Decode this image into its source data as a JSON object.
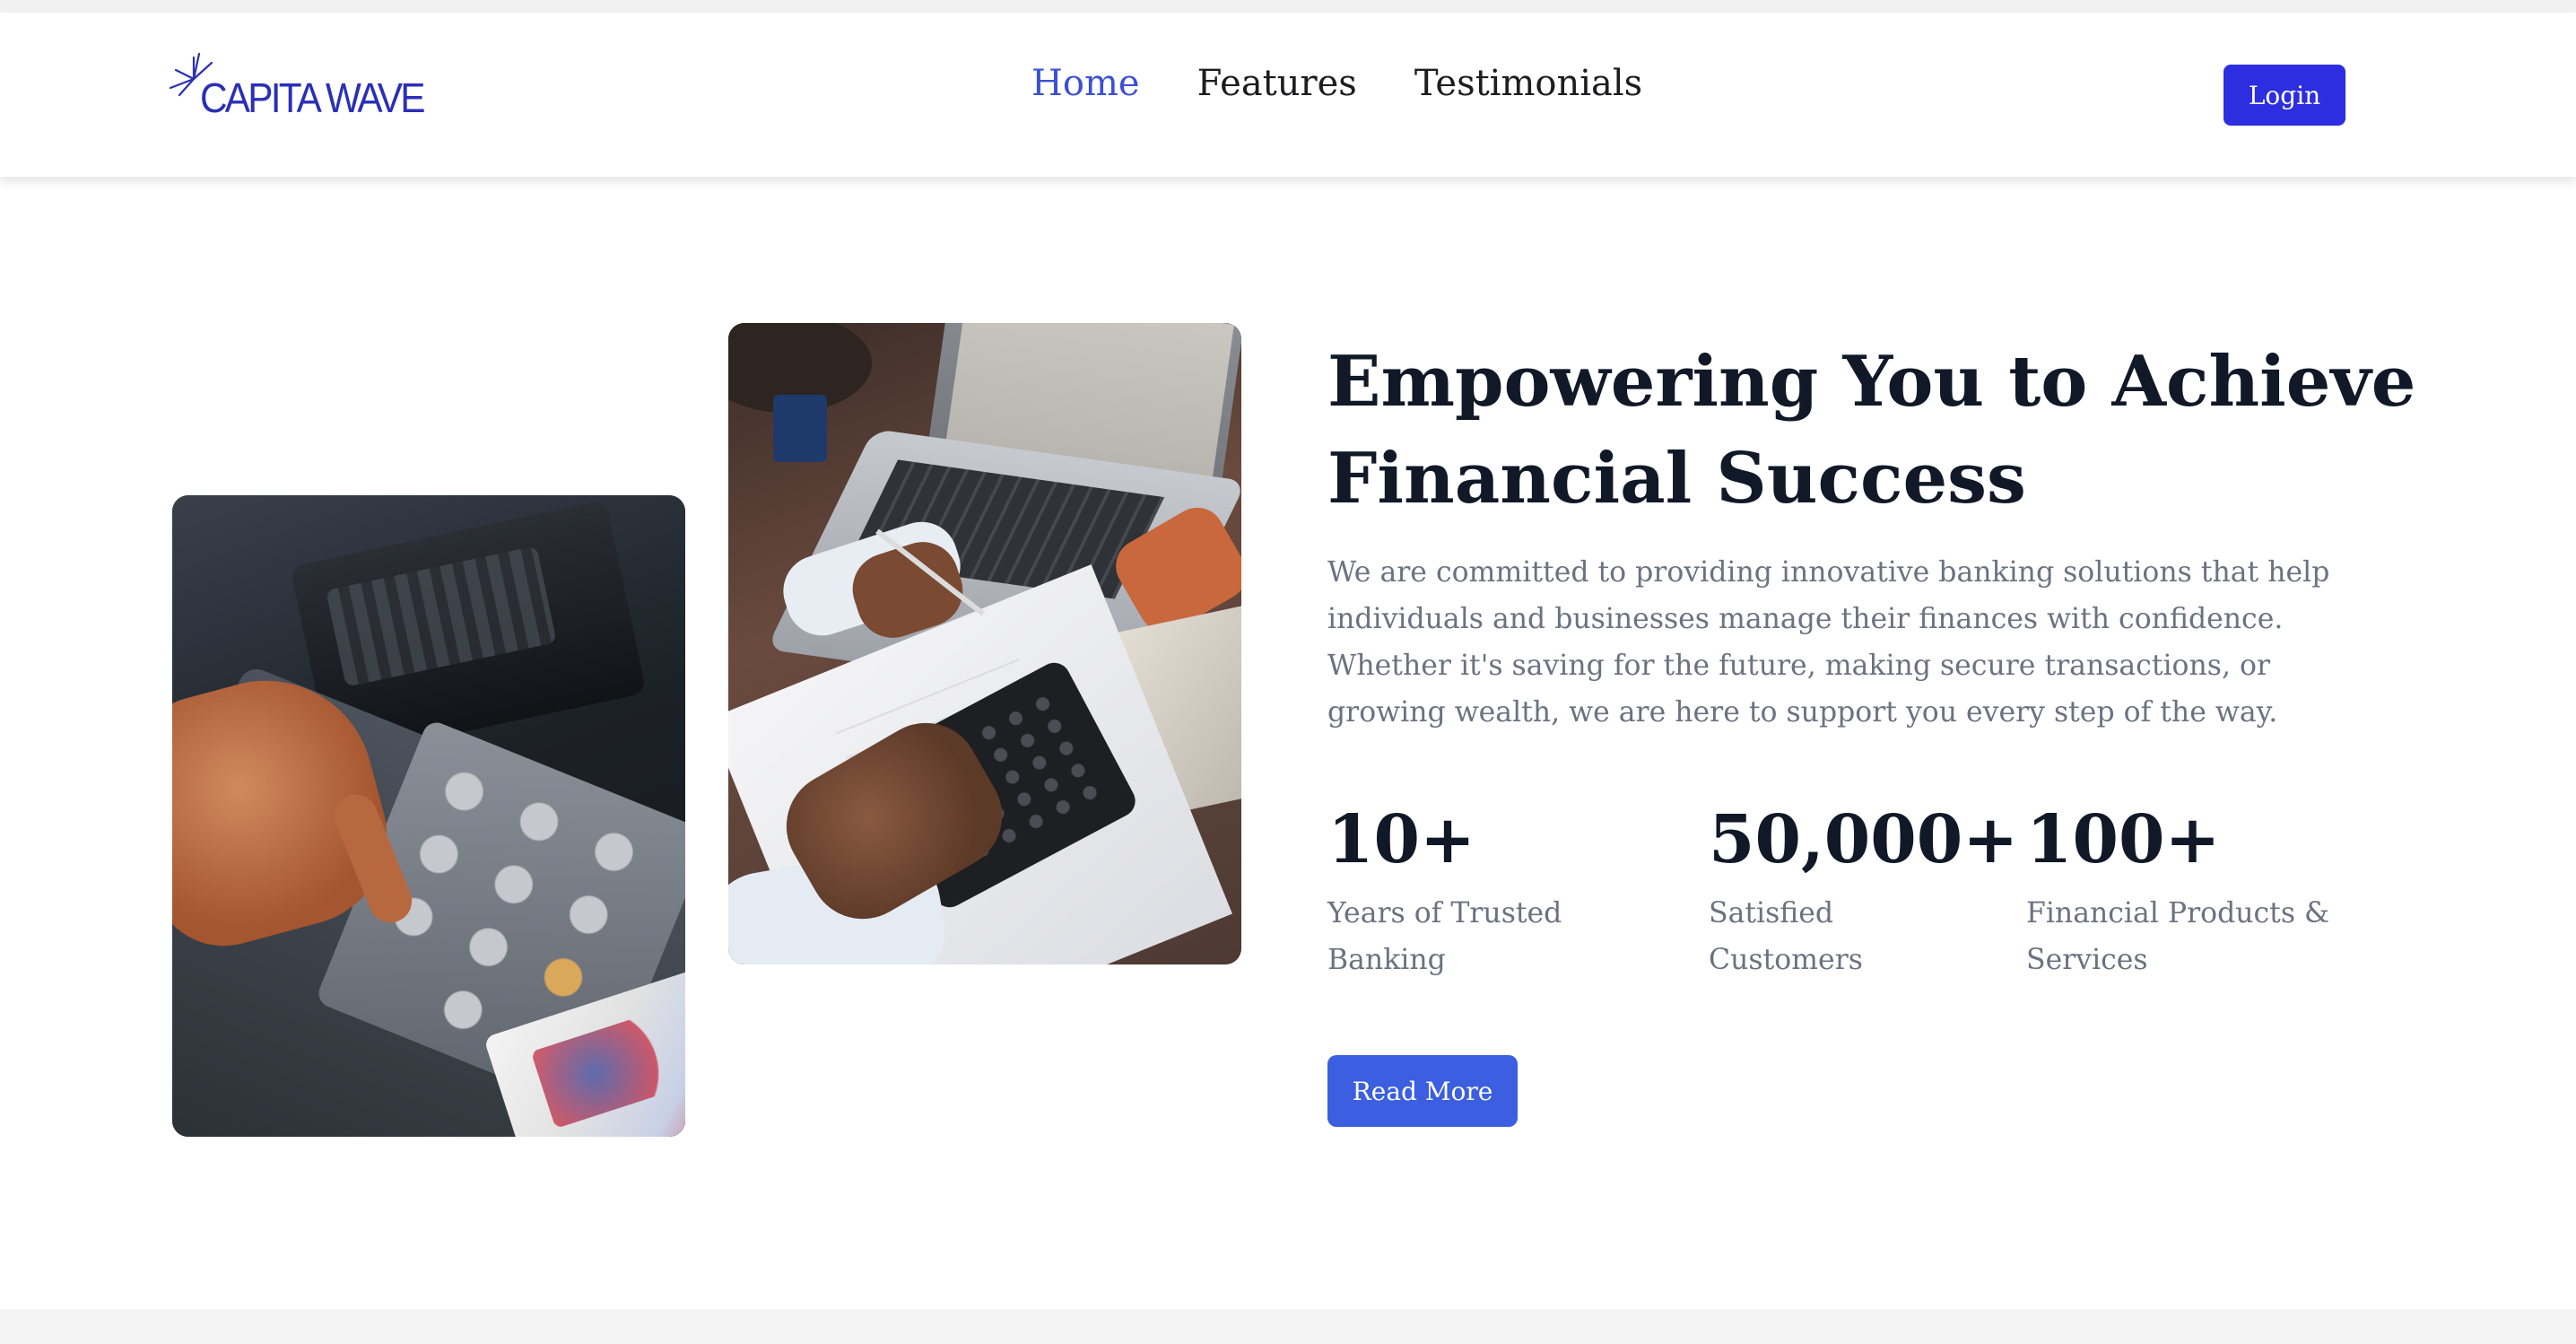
{
  "header": {
    "logo_text": "CAPITA WAVE",
    "nav": [
      {
        "label": "Home",
        "active": true
      },
      {
        "label": "Features",
        "active": false
      },
      {
        "label": "Testimonials",
        "active": false
      }
    ],
    "login_label": "Login"
  },
  "hero": {
    "title": "Empowering You to Achieve Financial Success",
    "description": "We are committed to providing innovative banking solutions that help individuals and businesses manage their finances with confidence. Whether it's saving for the future, making secure transactions, or growing wealth, we are here to support you every step of the way.",
    "stats": [
      {
        "value": "10+",
        "label": "Years of Trusted Banking"
      },
      {
        "value": "50,000+",
        "label": "Satisfied Customers"
      },
      {
        "value": "100+",
        "label": "Financial Products & Services"
      }
    ],
    "read_more_label": "Read More"
  },
  "colors": {
    "brand": "#2a2fb8",
    "nav_active": "#3b50d4",
    "login_button": "#2d2ee0",
    "primary_button": "#3b5fe0",
    "heading": "#111827",
    "body_text": "#6b7280"
  },
  "images": [
    {
      "name": "atm-keypad-photo"
    },
    {
      "name": "calculator-laptop-photo"
    }
  ]
}
